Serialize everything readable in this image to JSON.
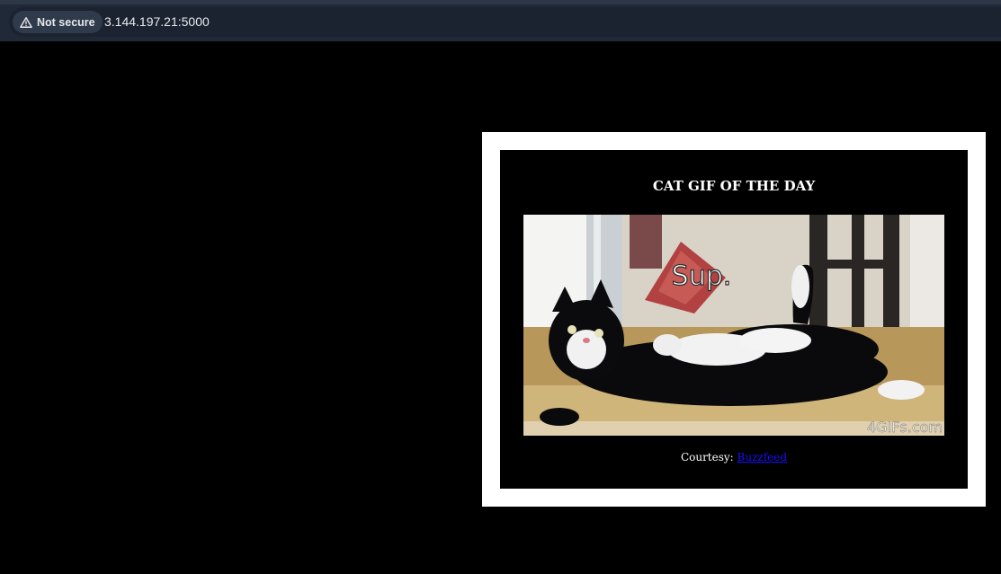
{
  "browser": {
    "security_label": "Not secure",
    "url": "3.144.197.21:5000"
  },
  "page": {
    "title": "CAT GIF OF THE DAY",
    "gif_caption": "Sup.",
    "gif_watermark": "4GIFs.com",
    "courtesy_prefix": "Courtesy: ",
    "courtesy_link": "Buzzfeed"
  },
  "colors": {
    "page_bg": "#000000",
    "card_border": "#ffffff",
    "link": "#1a0dff",
    "browser_bar": "#202938"
  },
  "icons": {
    "security": "warning-triangle-icon"
  }
}
